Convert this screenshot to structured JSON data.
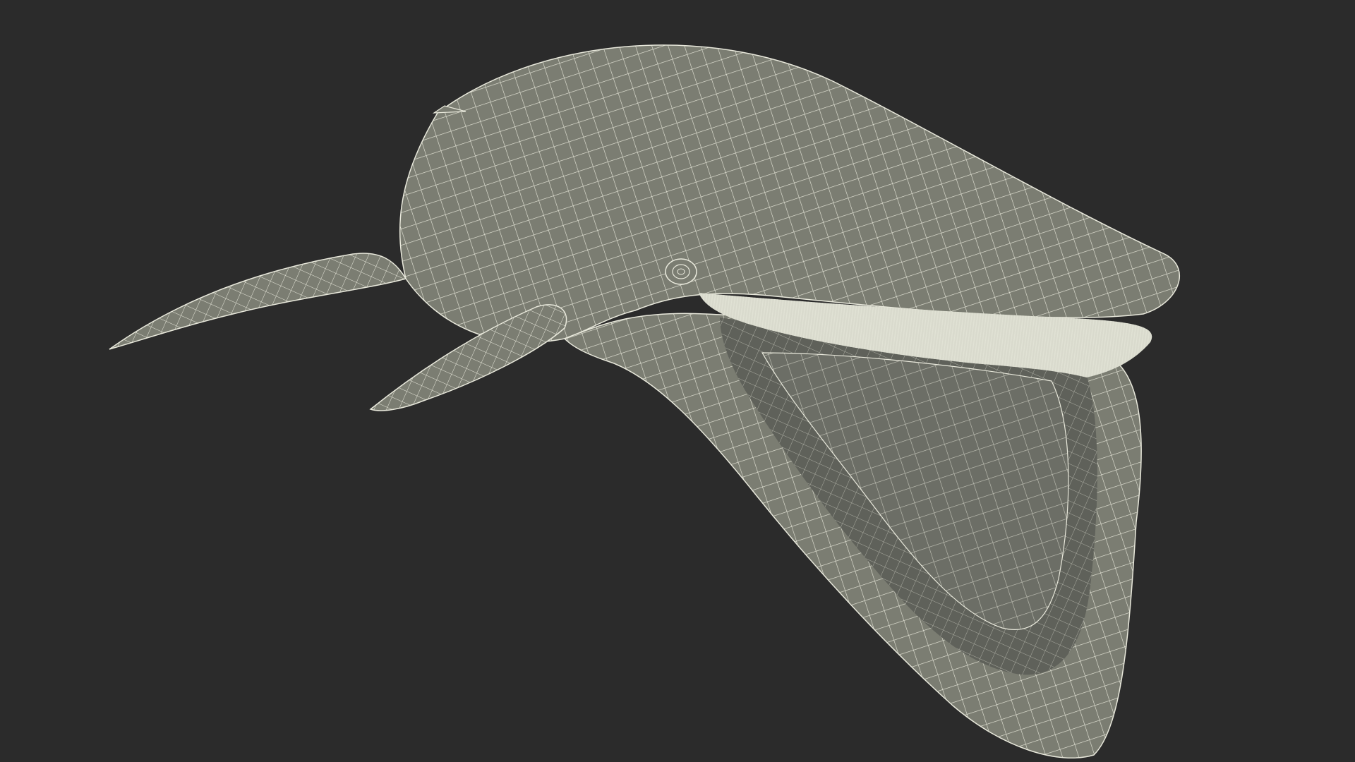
{
  "scene": {
    "background_color": "#2b2b2b",
    "mesh_fill_color": "#7b7d72",
    "mesh_shade_color": "#5f615a",
    "wire_color": "#e9e9dc",
    "baleen_color": "#d9dacd"
  },
  "subject": {
    "name": "whale-wireframe-model"
  }
}
